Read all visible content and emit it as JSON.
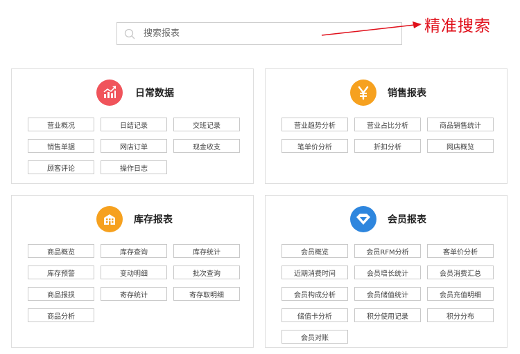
{
  "search": {
    "placeholder": "搜索报表",
    "annotation": "精准搜索"
  },
  "colors": {
    "daily": "#f0545b",
    "sales": "#f6a11f",
    "inventory": "#f6a11f",
    "member": "#2e86de",
    "annotation": "#e0101b"
  },
  "panels": [
    {
      "title": "日常数据",
      "icon": "trend-chart-icon",
      "items": [
        "营业概况",
        "日结记录",
        "交班记录",
        "销售单据",
        "网店订单",
        "现金收支",
        "顾客评论",
        "操作日志"
      ]
    },
    {
      "title": "销售报表",
      "icon": "yen-icon",
      "items": [
        "营业趋势分析",
        "营业占比分析",
        "商品销售统计",
        "笔单价分析",
        "折扣分析",
        "网店概览"
      ]
    },
    {
      "title": "库存报表",
      "icon": "building-icon",
      "items": [
        "商品概览",
        "库存查询",
        "库存统计",
        "库存预警",
        "变动明细",
        "批次查询",
        "商品报损",
        "寄存统计",
        "寄存取明细",
        "商品分析"
      ]
    },
    {
      "title": "会员报表",
      "icon": "diamond-icon",
      "items": [
        "会员概览",
        "会员RFM分析",
        "客单价分析",
        "近期消费时间",
        "会员增长统计",
        "会员消费汇总",
        "会员构成分析",
        "会员储值统计",
        "会员充值明细",
        "储值卡分析",
        "积分使用记录",
        "积分分布",
        "会员对账"
      ]
    }
  ]
}
